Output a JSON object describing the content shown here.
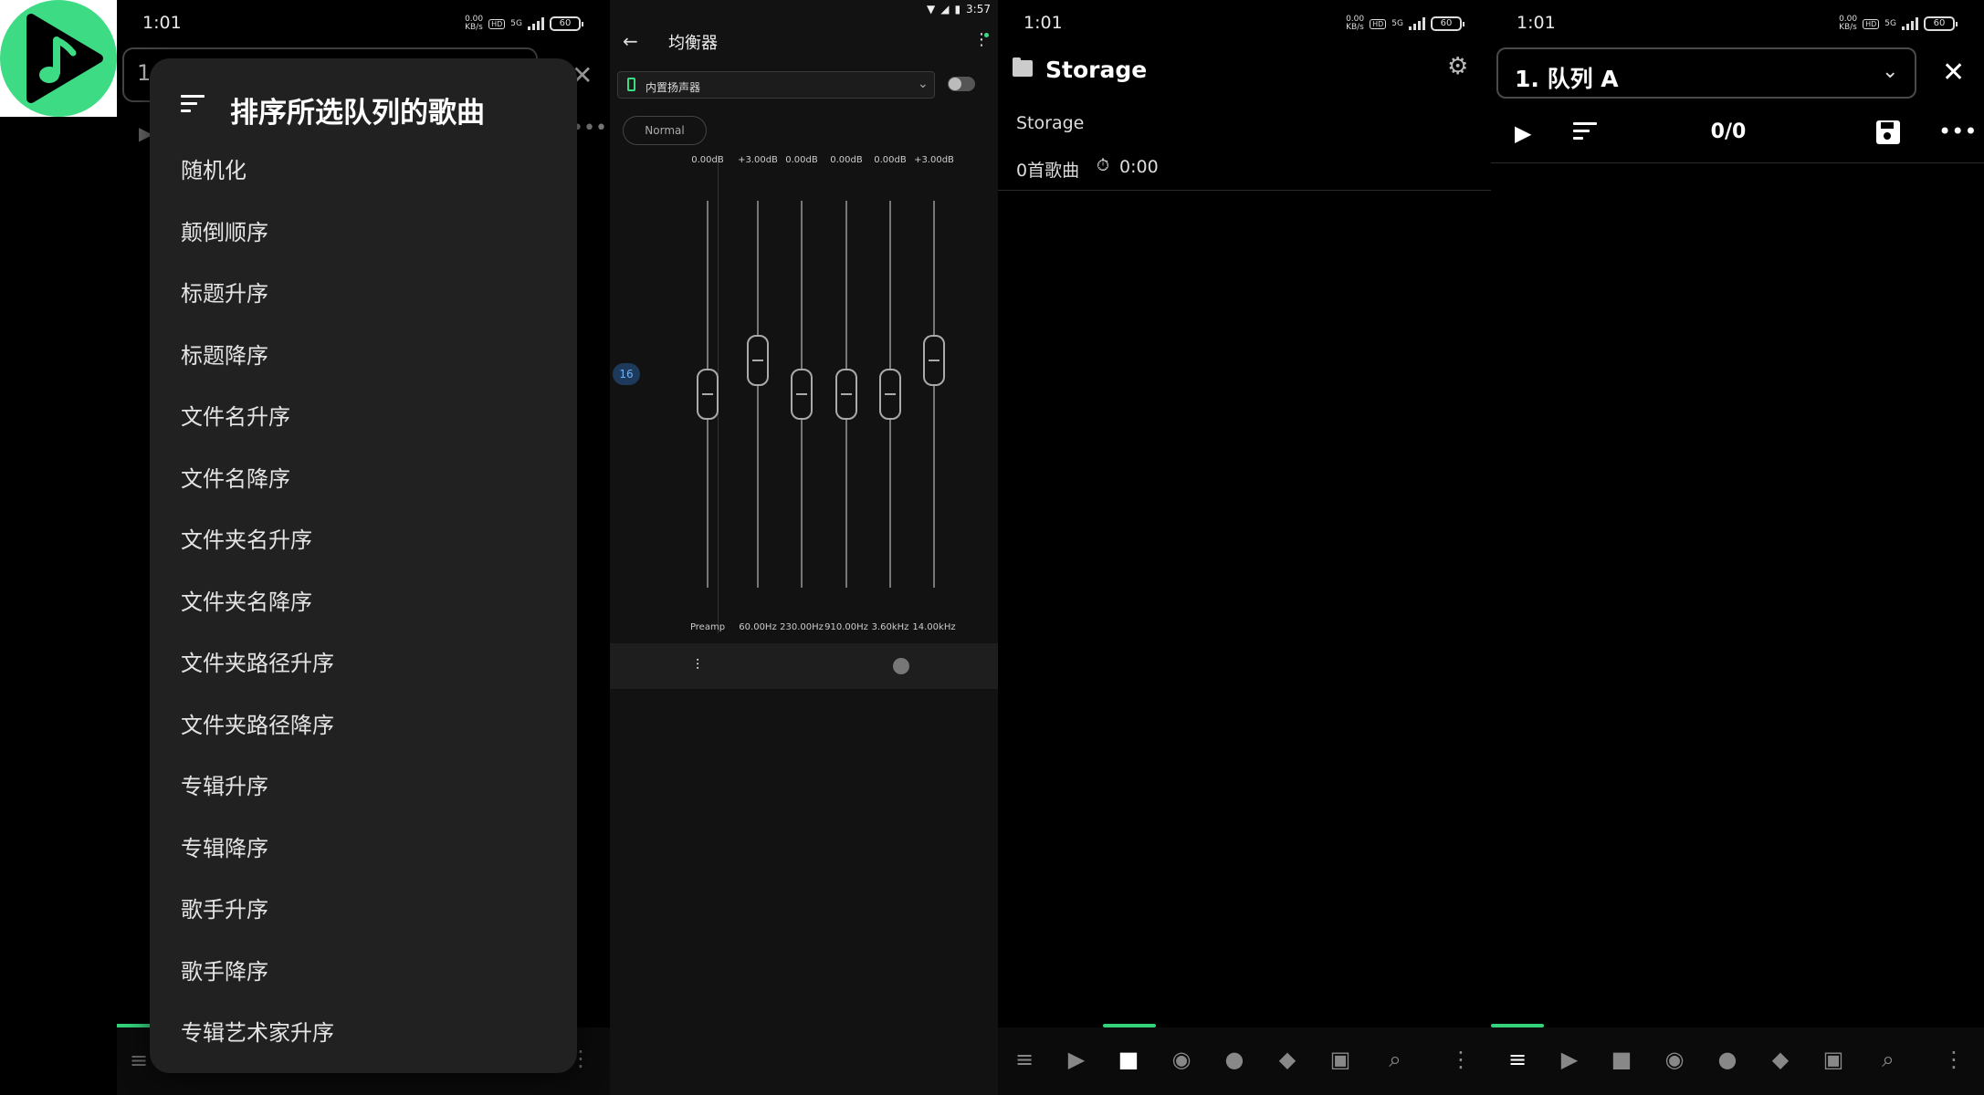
{
  "status": {
    "time": "1:01",
    "speed": "0.00",
    "speed_unit": "KB/s",
    "hd": "HD",
    "network": "5G",
    "battery": "60"
  },
  "equalizer_status": {
    "time": "3:57"
  },
  "sort_dialog": {
    "title": "排序所选队列的歌曲",
    "items": [
      "随机化",
      "颠倒顺序",
      "标题升序",
      "标题降序",
      "文件名升序",
      "文件名降序",
      "文件夹名升序",
      "文件夹名降序",
      "文件夹路径升序",
      "文件夹路径降序",
      "专辑升序",
      "专辑降序",
      "歌手升序",
      "歌手降序",
      "专辑艺术家升序"
    ]
  },
  "panel1": {
    "queue_number": "1"
  },
  "equalizer": {
    "title": "均衡器",
    "device": "内置扬声器",
    "enabled": false,
    "preset": "Normal",
    "preamp_badge": "16",
    "bands": [
      {
        "label": "Preamp",
        "gain": "0.00dB",
        "level": 0.5
      },
      {
        "label": "60.00Hz",
        "gain": "+3.00dB",
        "level": 0.6
      },
      {
        "label": "230.00Hz",
        "gain": "0.00dB",
        "level": 0.5
      },
      {
        "label": "910.00Hz",
        "gain": "0.00dB",
        "level": 0.5
      },
      {
        "label": "3.60kHz",
        "gain": "0.00dB",
        "level": 0.5
      },
      {
        "label": "14.00kHz",
        "gain": "+3.00dB",
        "level": 0.6
      }
    ]
  },
  "storage": {
    "title": "Storage",
    "subtitle": "Storage",
    "song_count": "0首歌曲",
    "duration": "0:00"
  },
  "queue": {
    "label": "1. 队列 A",
    "counter": "0/0"
  },
  "colors": {
    "accent": "#3ddc84",
    "background": "#000000",
    "dialog": "#212121"
  }
}
